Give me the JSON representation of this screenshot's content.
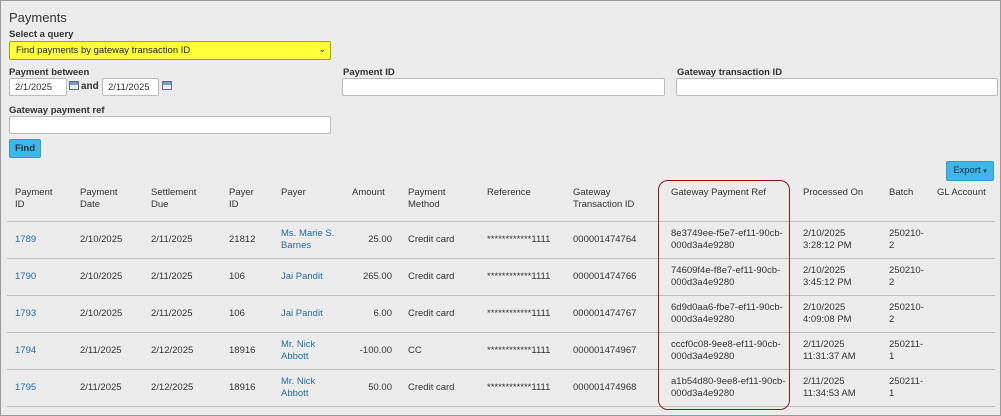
{
  "page": {
    "title": "Payments"
  },
  "query": {
    "label": "Select a query",
    "selected": "Find payments by gateway transaction ID"
  },
  "filters": {
    "payment_between_label": "Payment between",
    "date_from": "2/1/2025",
    "and_label": "and",
    "date_to": "2/11/2025",
    "payment_id_label": "Payment ID",
    "payment_id_value": "",
    "gateway_txn_label": "Gateway transaction ID",
    "gateway_txn_value": "",
    "gateway_ref_label": "Gateway payment ref",
    "gateway_ref_value": ""
  },
  "buttons": {
    "find": "Find",
    "export": "Export",
    "export_caret": "▾"
  },
  "table": {
    "columns": [
      {
        "label": "Payment ID",
        "name": "col-payment-id"
      },
      {
        "label": "Payment Date",
        "name": "col-payment-date"
      },
      {
        "label": "Settlement Due",
        "name": "col-settlement-due"
      },
      {
        "label": "Payer ID",
        "name": "col-payer-id"
      },
      {
        "label": "Payer",
        "name": "col-payer"
      },
      {
        "label": "Amount",
        "name": "col-amount"
      },
      {
        "label": "Payment Method",
        "name": "col-payment-method"
      },
      {
        "label": "Reference",
        "name": "col-reference"
      },
      {
        "label": "Gateway Transaction ID",
        "name": "col-gateway-transaction-id"
      },
      {
        "label": "Gateway Payment Ref",
        "name": "col-gateway-payment-ref"
      },
      {
        "label": "Processed On",
        "name": "col-processed-on"
      },
      {
        "label": "Batch",
        "name": "col-batch"
      },
      {
        "label": "GL Account",
        "name": "col-gl-account"
      }
    ],
    "rows": [
      {
        "payment_id": "1789",
        "payment_date": "2/10/2025",
        "settlement_due": "2/11/2025",
        "payer_id": "21812",
        "payer": "Ms. Marie S. Barnes",
        "amount": "25.00",
        "method": "Credit card",
        "reference": "************1111",
        "gateway_txn": "000001474764",
        "gateway_ref": "8e3749ee-f5e7-ef11-90cb-000d3a4e9280",
        "processed_on": "2/10/2025 3:28:12 PM",
        "batch": "250210-2",
        "gl_account": ""
      },
      {
        "payment_id": "1790",
        "payment_date": "2/10/2025",
        "settlement_due": "2/11/2025",
        "payer_id": "106",
        "payer": "Jai Pandit",
        "amount": "265.00",
        "method": "Credit card",
        "reference": "************1111",
        "gateway_txn": "000001474766",
        "gateway_ref": "74609f4e-f8e7-ef11-90cb-000d3a4e9280",
        "processed_on": "2/10/2025 3:45:12 PM",
        "batch": "250210-2",
        "gl_account": ""
      },
      {
        "payment_id": "1793",
        "payment_date": "2/10/2025",
        "settlement_due": "2/11/2025",
        "payer_id": "106",
        "payer": "Jai Pandit",
        "amount": "6.00",
        "method": "Credit card",
        "reference": "************1111",
        "gateway_txn": "000001474767",
        "gateway_ref": "6d9d0aa6-fbe7-ef11-90cb-000d3a4e9280",
        "processed_on": "2/10/2025 4:09:08 PM",
        "batch": "250210-2",
        "gl_account": ""
      },
      {
        "payment_id": "1794",
        "payment_date": "2/11/2025",
        "settlement_due": "2/12/2025",
        "payer_id": "18916",
        "payer": "Mr. Nick Abbott",
        "amount": "-100.00",
        "method": "CC",
        "reference": "************1111",
        "gateway_txn": "000001474967",
        "gateway_ref": "cccf0c08-9ee8-ef11-90cb-000d3a4e9280",
        "processed_on": "2/11/2025 11:31:37 AM",
        "batch": "250211-1",
        "gl_account": ""
      },
      {
        "payment_id": "1795",
        "payment_date": "2/11/2025",
        "settlement_due": "2/12/2025",
        "payer_id": "18916",
        "payer": "Mr. Nick Abbott",
        "amount": "50.00",
        "method": "Credit card",
        "reference": "************1111",
        "gateway_txn": "000001474968",
        "gateway_ref": "a1b54d80-9ee8-ef11-90cb-000d3a4e9280",
        "processed_on": "2/11/2025 11:34:53 AM",
        "batch": "250211-1",
        "gl_account": ""
      }
    ]
  },
  "icons": {
    "calendar": "calendar-icon",
    "chevron": "chevron-down-icon"
  },
  "colors": {
    "query_highlight": "#ffff3a",
    "button": "#3fb6e8",
    "link": "#1f6fa3",
    "annotation": "#8b1a1a"
  }
}
